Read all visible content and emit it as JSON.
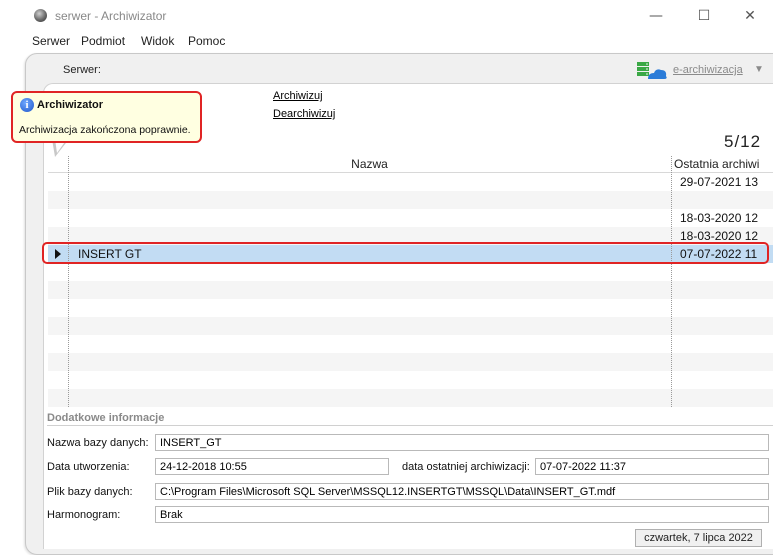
{
  "window": {
    "title_app": "serwer",
    "title_sep": " - ",
    "title_name": "Archiwizator",
    "minimize": "—",
    "maximize": "☐",
    "close": "✕"
  },
  "menu": [
    "Serwer",
    "Podmiot",
    "Widok",
    "Pomoc"
  ],
  "toolbar": {
    "serwer_label": "Serwer:",
    "earchive_label": "e-archiwizacja",
    "earchive_arrow": "▼",
    "earchive_icon": "cloud-server-icon"
  },
  "links": {
    "archiwizuj": "Archiwizuj",
    "dearchiwizuj": "Dearchiwizuj"
  },
  "tooltip": {
    "icon": "info-icon",
    "title": "Archiwizator",
    "message": "Archiwizacja zakończona poprawnie."
  },
  "counter": "5/12",
  "grid": {
    "columns": [
      "Nazwa",
      "Ostatnia archiwi"
    ],
    "rows": [
      {
        "name": "",
        "date": "29-07-2021 13"
      },
      {
        "name": "",
        "date": ""
      },
      {
        "name": "",
        "date": "18-03-2020 12"
      },
      {
        "name": "",
        "date": "18-03-2020 12"
      },
      {
        "name": "INSERT GT",
        "date": "07-07-2022 11",
        "selected": true
      }
    ]
  },
  "details": {
    "section_title": "Dodatkowe informacje",
    "db_name_label": "Nazwa bazy danych:",
    "db_name_value": "INSERT_GT",
    "created_label": "Data utworzenia:",
    "created_value": "24-12-2018 10:55",
    "last_archive_label": "data ostatniej archiwizacji:",
    "last_archive_value": "07-07-2022 11:37",
    "file_label": "Plik bazy danych:",
    "file_value": "C:\\Program Files\\Microsoft SQL Server\\MSSQL12.INSERTGT\\MSSQL\\Data\\INSERT_GT.mdf",
    "schedule_label": "Harmonogram:",
    "schedule_value": "Brak"
  },
  "status": {
    "date": "czwartek, 7 lipca 2022"
  },
  "colors": {
    "highlight_frame": "#e02424",
    "tooltip_bg": "#ffffe1",
    "selected_row": "#c2dcf3"
  }
}
